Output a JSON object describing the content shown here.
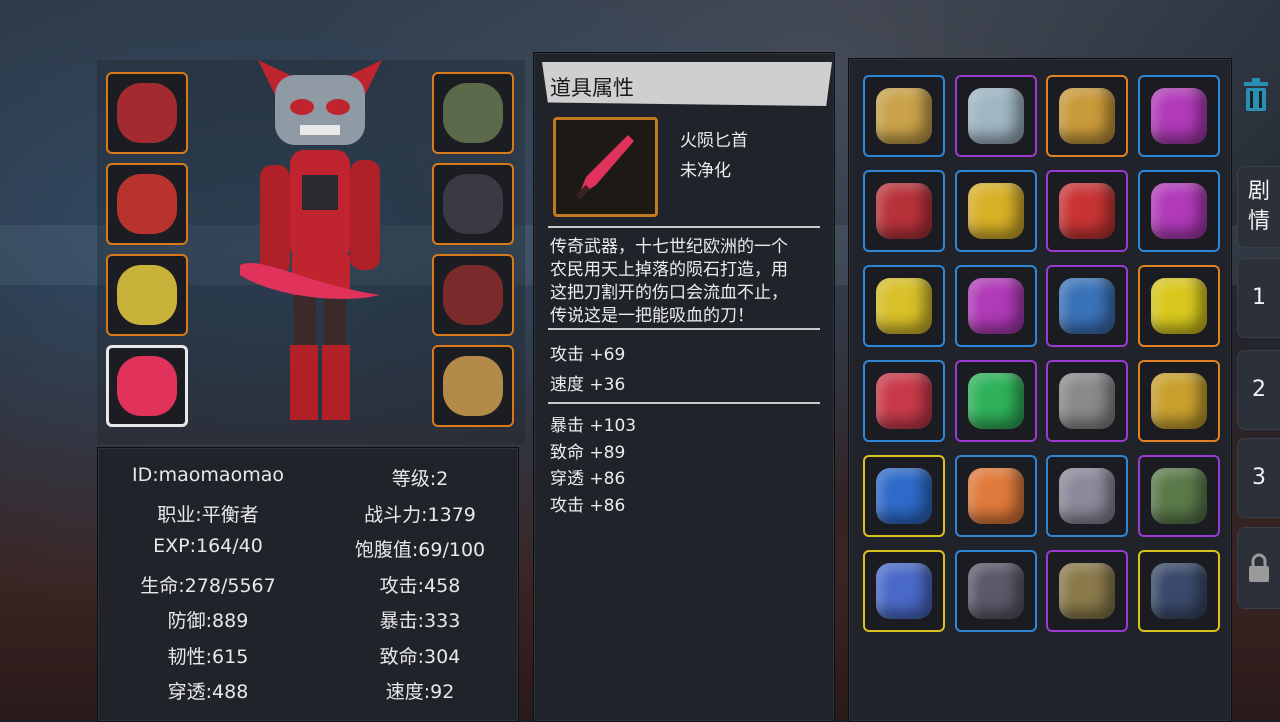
{
  "colors": {
    "rarity_blue": "#2e87d6",
    "rarity_purple": "#9a3ad1",
    "rarity_orange": "#e08221",
    "rarity_yellow": "#d8c21b",
    "weapon_accent": "#e0325a"
  },
  "equipment": {
    "left_slots": [
      {
        "icon": "oni-mask-helmet-icon"
      },
      {
        "icon": "red-armor-icon"
      },
      {
        "icon": "yellow-pants-icon"
      },
      {
        "icon": "crimson-dagger-icon",
        "selected": true
      }
    ],
    "right_slots": [
      {
        "icon": "green-gem-necklace-icon"
      },
      {
        "icon": "spiked-ring-icon"
      },
      {
        "icon": "fingerless-gloves-icon"
      },
      {
        "icon": "leather-boots-icon"
      }
    ]
  },
  "character_stats": [
    {
      "left": "ID:maomaomao",
      "right": "等级:2"
    },
    {
      "left": "职业:平衡者",
      "right": "战斗力:1379"
    },
    {
      "left": "EXP:164/40",
      "right": "饱腹值:69/100"
    },
    {
      "left": "生命:278/5567",
      "right": "攻击:458"
    },
    {
      "left": "防御:889",
      "right": "暴击:333"
    },
    {
      "left": "韧性:615",
      "right": "致命:304"
    },
    {
      "left": "穿透:488",
      "right": "速度:92"
    }
  ],
  "item_detail": {
    "header": "道具属性",
    "name": "火陨匕首",
    "status": "未净化",
    "description_lines": [
      "传奇武器，十七世纪欧洲的一个",
      "农民用天上掉落的陨石打造，用",
      "这把刀割开的伤口会流血不止，",
      "传说这是一把能吸血的刀！"
    ],
    "base_stats": [
      "攻击 +69",
      "速度 +36"
    ],
    "bonus_stats": [
      "暴击 +103",
      "致命 +89",
      "穿透 +86",
      "攻击 +86"
    ]
  },
  "inventory": {
    "rows": [
      [
        {
          "rarity": "blue",
          "icon": "gold-gauntlet-icon",
          "color": "#c9a24a"
        },
        {
          "rarity": "purple",
          "icon": "silver-gauntlet-icon",
          "color": "#9fb6c4"
        },
        {
          "rarity": "orange",
          "icon": "gold-bracer-icon",
          "color": "#c99a3a"
        },
        {
          "rarity": "blue",
          "icon": "purple-fist-icon",
          "color": "#b03ab8"
        }
      ],
      [
        {
          "rarity": "blue",
          "icon": "red-spiked-gauntlet-icon",
          "color": "#b8323a"
        },
        {
          "rarity": "blue",
          "icon": "gold-claw-icon",
          "color": "#d8b028"
        },
        {
          "rarity": "purple",
          "icon": "red-knuckle-icon",
          "color": "#c83434"
        },
        {
          "rarity": "blue",
          "icon": "purple-fist-icon",
          "color": "#b03ab8"
        }
      ],
      [
        {
          "rarity": "blue",
          "icon": "gold-spiked-fist-icon",
          "color": "#d8c028"
        },
        {
          "rarity": "blue",
          "icon": "purple-fist-icon",
          "color": "#b03ab8"
        },
        {
          "rarity": "purple",
          "icon": "blue-spiked-mask-icon",
          "color": "#3a72b8"
        },
        {
          "rarity": "orange",
          "icon": "yellow-goggles-icon",
          "color": "#d8c81e"
        }
      ],
      [
        {
          "rarity": "blue",
          "icon": "red-goggles-icon",
          "color": "#c83a4a"
        },
        {
          "rarity": "purple",
          "icon": "green-goggles-icon",
          "color": "#2eb25a"
        },
        {
          "rarity": "purple",
          "icon": "visor-icon",
          "color": "#8a8a8a"
        },
        {
          "rarity": "orange",
          "icon": "diving-mask-icon",
          "color": "#c8a02e"
        }
      ],
      [
        {
          "rarity": "yellow",
          "icon": "blue-goggles-icon",
          "color": "#2e6ac8"
        },
        {
          "rarity": "blue",
          "icon": "orange-helmet-icon",
          "color": "#e07a3a"
        },
        {
          "rarity": "blue",
          "icon": "robot-helmet-icon",
          "color": "#8a8a9a"
        },
        {
          "rarity": "purple",
          "icon": "green-helmet-icon",
          "color": "#5a7a4a"
        }
      ],
      [
        {
          "rarity": "yellow",
          "icon": "blue-vest-icon",
          "color": "#4a6ac8"
        },
        {
          "rarity": "blue",
          "icon": "armored-vest-icon",
          "color": "#5a5a6a"
        },
        {
          "rarity": "purple",
          "icon": "camo-vest-icon",
          "color": "#8a7a4a"
        },
        {
          "rarity": "yellow",
          "icon": "dark-armor-icon",
          "color": "#3a4a6a"
        }
      ]
    ]
  },
  "side_tabs": [
    {
      "label": "剧\n情"
    },
    {
      "label": "1"
    },
    {
      "label": "2"
    },
    {
      "label": "3"
    }
  ]
}
